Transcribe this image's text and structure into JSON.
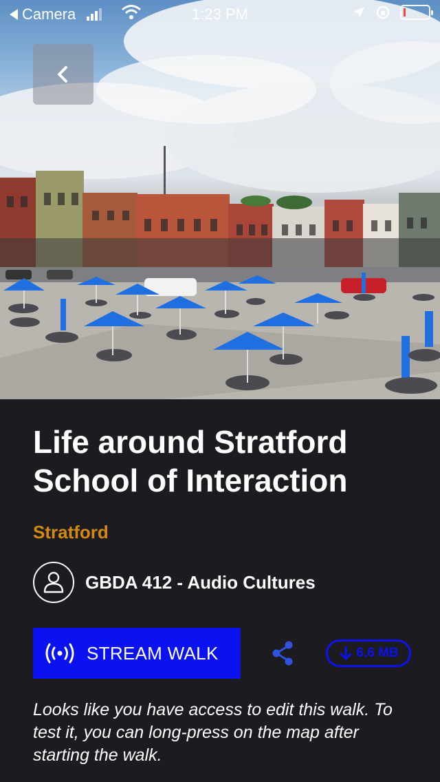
{
  "status_bar": {
    "back_app": "Camera",
    "time": "1:23 PM"
  },
  "icons": {
    "back": "chevron-left-icon",
    "stream": "broadcast-icon",
    "share": "share-icon",
    "download": "arrow-down-icon",
    "avatar": "person-icon"
  },
  "walk": {
    "title": "Life around Stratford School of Interaction",
    "city": "Stratford",
    "course": "GBDA 412 - Audio Cultures",
    "stream_label": "STREAM WALK",
    "download_size": "6.6 MB",
    "note": "Looks like you have access to edit this walk. To test it, you can long-press on the map after starting the walk."
  },
  "colors": {
    "background": "#1c1b1f",
    "accent_blue": "#0a12f0",
    "city_orange": "#d4890f"
  }
}
